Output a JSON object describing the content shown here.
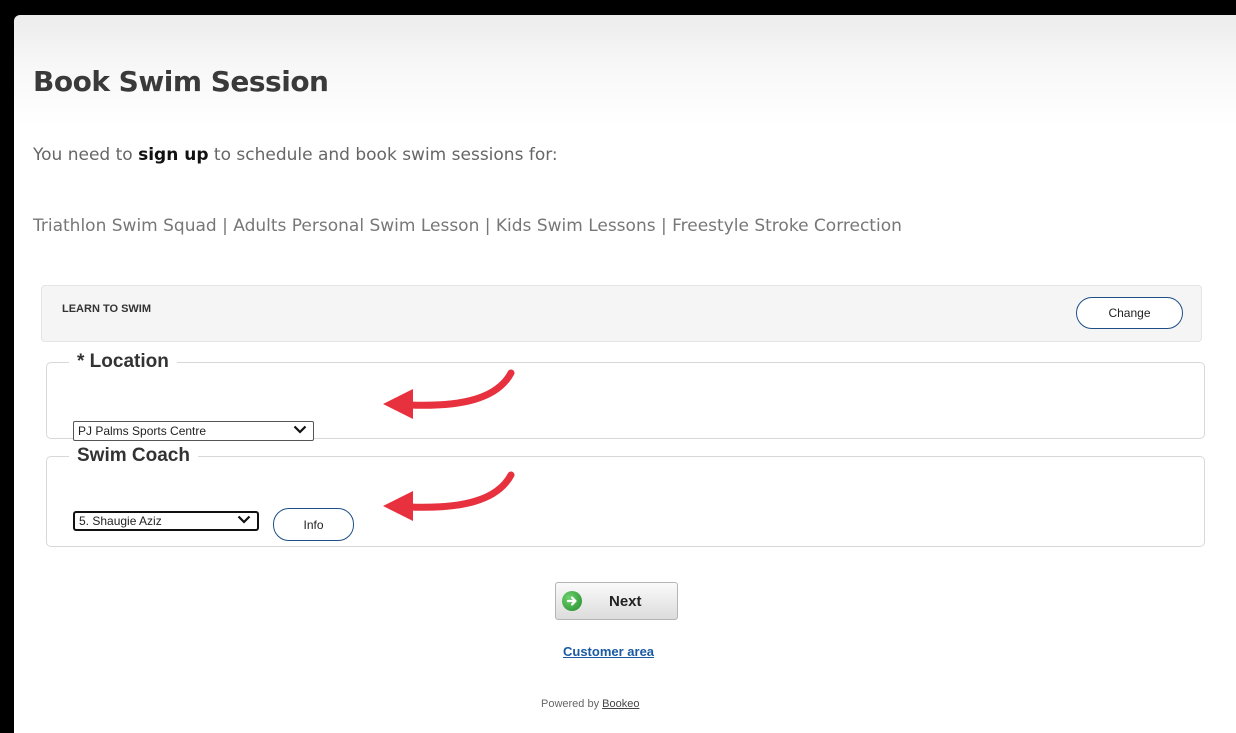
{
  "page": {
    "title": "Book Swim Session",
    "intro_prefix": "You need to",
    "intro_link": "sign up",
    "intro_suffix": "to schedule and book swim sessions for:",
    "services": "Triathlon Swim Squad | Adults Personal Swim Lesson | Kids Swim Lessons | Freestyle Stroke Correction"
  },
  "category": {
    "label": "LEARN TO SWIM",
    "change_label": "Change"
  },
  "location": {
    "legend": "* Location",
    "selected": "PJ Palms Sports Centre"
  },
  "coach": {
    "legend": "Swim Coach",
    "selected": "5. Shaugie Aziz",
    "info_label": "Info"
  },
  "footer": {
    "next_label": "Next",
    "customer_area": "Customer area",
    "powered_prefix": "Powered by",
    "powered_link": "Bookeo"
  },
  "colors": {
    "arrow": "#e8313f",
    "link": "#1a5aa3",
    "button_border": "#1d4f86"
  },
  "icons": {
    "next": "green-arrow-right-circle",
    "select": "chevron-down"
  }
}
